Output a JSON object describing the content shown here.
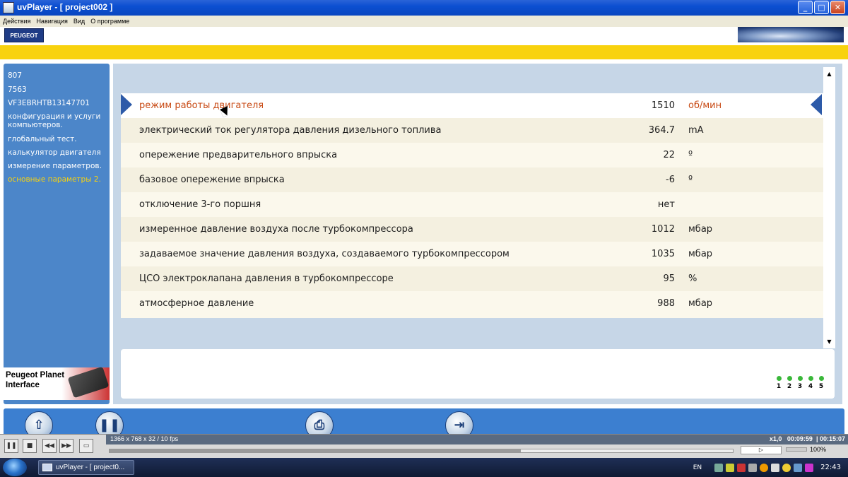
{
  "window": {
    "title": "uvPlayer - [ project002 ]",
    "controls": [
      "_",
      "□",
      "✕"
    ]
  },
  "menu": {
    "items": [
      "Действия",
      "Навигация",
      "Вид",
      "О программе"
    ]
  },
  "header": {
    "logo_text": "PEUGEOT"
  },
  "sidebar": {
    "items": [
      {
        "label": "807",
        "active": false
      },
      {
        "label": "7563",
        "active": false
      },
      {
        "label": "VF3EBRHTB13147701",
        "active": false
      },
      {
        "label": "конфигурация и услуги компьютеров.",
        "active": false
      },
      {
        "label": "глобальный тест.",
        "active": false
      },
      {
        "label": "калькулятор двигателя",
        "active": false
      },
      {
        "label": "измерение параметров.",
        "active": false
      },
      {
        "label": "основные параметры 2.",
        "active": true
      }
    ],
    "ppi_label": "Peugeot Planet Interface"
  },
  "parameters": [
    {
      "name": "режим работы двигателя",
      "value": "1510",
      "unit": "об/мин"
    },
    {
      "name": "электрический ток регулятора давления дизельного топлива",
      "value": "364.7",
      "unit": "mA"
    },
    {
      "name": "опережение предварительного впрыска",
      "value": "22",
      "unit": "º"
    },
    {
      "name": "базовое опережение впрыска",
      "value": "-6",
      "unit": "º"
    },
    {
      "name": "отключение 3-го поршня",
      "value": "нет",
      "unit": ""
    },
    {
      "name": "измеренное давление воздуха после турбокомпрессора",
      "value": "1012",
      "unit": "мбар"
    },
    {
      "name": "задаваемое значение давления воздуха, создаваемого турбокомпрессором",
      "value": "1035",
      "unit": "мбар"
    },
    {
      "name": "ЦСО электроклапана давления в турбокомпрессоре",
      "value": "95",
      "unit": "%"
    },
    {
      "name": "атмосферное давление",
      "value": "988",
      "unit": "мбар"
    }
  ],
  "selected_row": 0,
  "pagination": {
    "pages": [
      "1",
      "2",
      "3",
      "4",
      "5"
    ],
    "dot_color": "#3ab83a"
  },
  "player": {
    "resolution_text": "1366 x 768 x 32 / 10 fps",
    "speed": "x1,0",
    "time_current": "00:09:59",
    "time_total": "00:15:07",
    "volume_text": "100%",
    "progress": 0.66
  },
  "taskbar": {
    "item_label": "uvPlayer - [ project0...",
    "language": "EN",
    "clock": "22:43"
  },
  "colors": {
    "accent_yellow": "#f8d20e",
    "sidebar_blue": "#4c86c9",
    "selected_text": "#c84a14",
    "pointer_blue": "#2d5aa8"
  }
}
